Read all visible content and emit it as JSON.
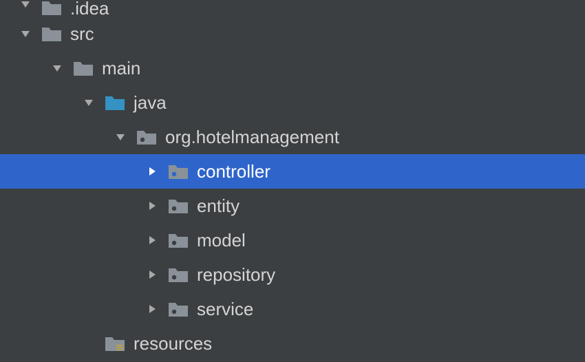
{
  "colors": {
    "bg": "#3c3f41",
    "selection": "#2f65ca",
    "text": "#d4d4d4",
    "arrow": "#a9a9a9",
    "arrowSelected": "#ffffff",
    "folderGrey": "#8a9199",
    "folderTeal": "#3592c4",
    "resourceStripe": "#b8a34a"
  },
  "tree": {
    "idea": {
      "label": ".idea",
      "expanded": false,
      "depth": 1,
      "iconColor": "grey",
      "selected": false,
      "iconType": "folder"
    },
    "src": {
      "label": "src",
      "expanded": true,
      "depth": 1,
      "iconColor": "grey",
      "selected": false,
      "iconType": "folder"
    },
    "main": {
      "label": "main",
      "expanded": true,
      "depth": 2,
      "iconColor": "grey",
      "selected": false,
      "iconType": "folder"
    },
    "java": {
      "label": "java",
      "expanded": true,
      "depth": 3,
      "iconColor": "teal",
      "selected": false,
      "iconType": "folder"
    },
    "pkg": {
      "label": "org.hotelmanagement",
      "expanded": true,
      "depth": 4,
      "iconColor": "grey",
      "selected": false,
      "iconType": "package"
    },
    "controller": {
      "label": "controller",
      "expanded": false,
      "depth": 5,
      "iconColor": "grey",
      "selected": true,
      "iconType": "package"
    },
    "entity": {
      "label": "entity",
      "expanded": false,
      "depth": 5,
      "iconColor": "grey",
      "selected": false,
      "iconType": "package"
    },
    "model": {
      "label": "model",
      "expanded": false,
      "depth": 5,
      "iconColor": "grey",
      "selected": false,
      "iconType": "package"
    },
    "repository": {
      "label": "repository",
      "expanded": false,
      "depth": 5,
      "iconColor": "grey",
      "selected": false,
      "iconType": "package"
    },
    "service": {
      "label": "service",
      "expanded": false,
      "depth": 5,
      "iconColor": "grey",
      "selected": false,
      "iconType": "package"
    },
    "resources": {
      "label": "resources",
      "expanded": null,
      "depth": 3,
      "iconColor": "grey",
      "selected": false,
      "iconType": "resources"
    }
  }
}
